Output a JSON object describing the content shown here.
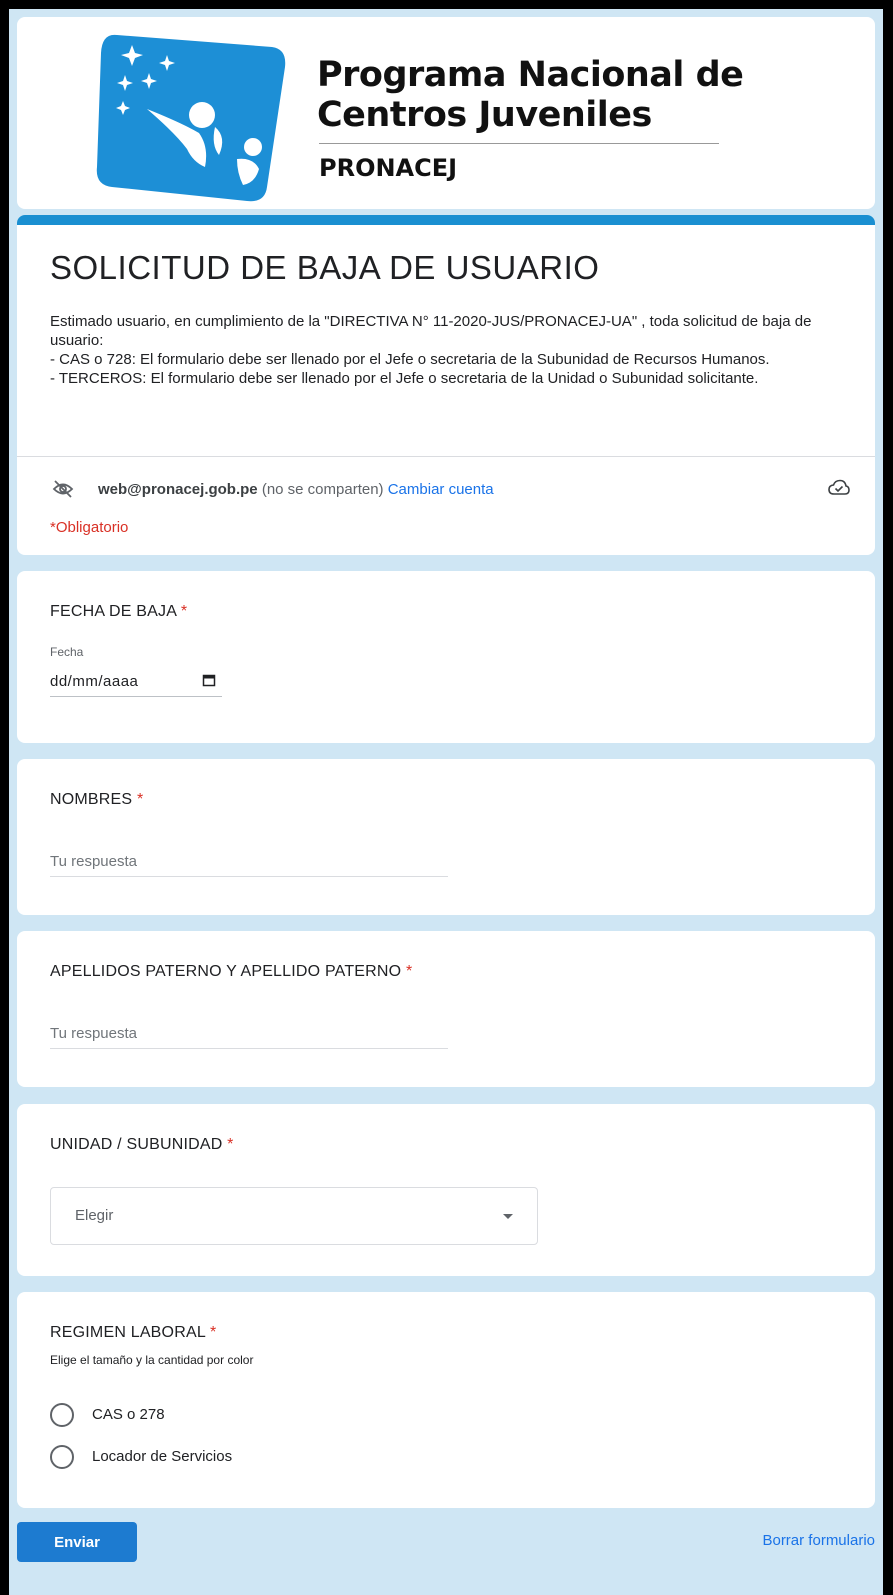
{
  "header": {
    "brand_line1": "Programa Nacional de",
    "brand_line2": "Centros Juveniles",
    "brand_sub": "PRONACEJ"
  },
  "form": {
    "title": "SOLICITUD DE BAJA DE USUARIO",
    "description": "Estimado usuario, en cumplimiento de la \"DIRECTIVA N° 11-2020-JUS/PRONACEJ-UA\" , toda solicitud de baja de usuario:\n- CAS o 728: El formulario debe ser llenado por el Jefe o secretaria de la Subunidad de Recursos Humanos.\n- TERCEROS: El formulario debe ser llenado por el Jefe o secretaria de la Unidad o Subunidad solicitante.",
    "account_email": "web@pronacej.gob.pe",
    "account_note": " (no se comparten) ",
    "switch_account": "Cambiar cuenta",
    "required_note": "*Obligatorio"
  },
  "questions": {
    "fecha": {
      "title": "FECHA DE BAJA ",
      "sublabel": "Fecha",
      "value": "dd/mm/aaaa"
    },
    "nombres": {
      "title": "NOMBRES ",
      "placeholder": "Tu respuesta"
    },
    "apellidos": {
      "title": "APELLIDOS PATERNO Y APELLIDO PATERNO ",
      "placeholder": "Tu respuesta"
    },
    "unidad": {
      "title": "UNIDAD / SUBUNIDAD ",
      "selected": "Elegir"
    },
    "regimen": {
      "title": "REGIMEN LABORAL ",
      "help": "Elige el tamaño y la cantidad por color",
      "options": [
        "CAS o 278",
        "Locador de Servicios"
      ]
    },
    "required_mark": "*"
  },
  "footer": {
    "submit": "Enviar",
    "clear": "Borrar formulario"
  },
  "colors": {
    "accent": "#1a8fd1",
    "background": "#cfe6f4",
    "required": "#d93025",
    "link": "#1a73e8"
  }
}
